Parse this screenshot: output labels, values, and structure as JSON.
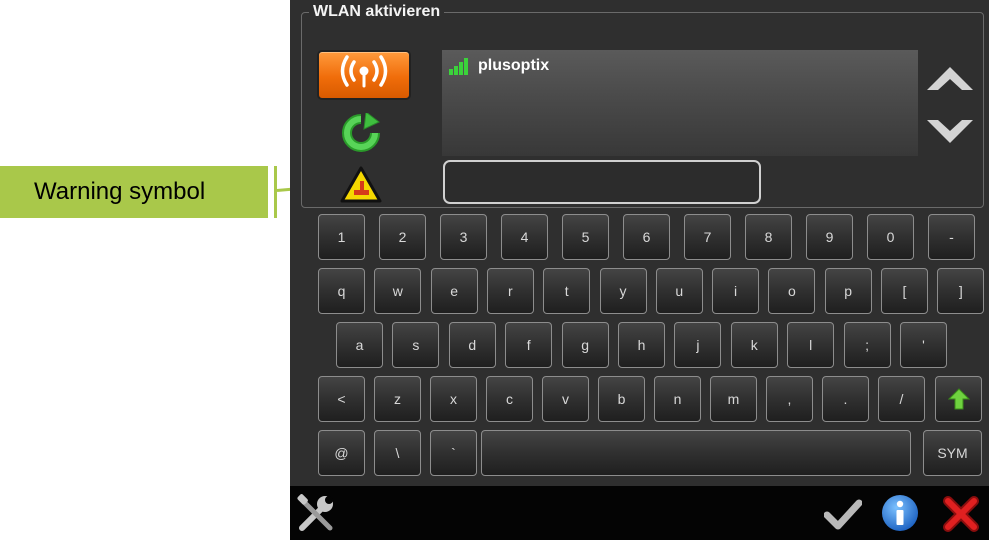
{
  "callout": {
    "label": "Warning symbol"
  },
  "wlan": {
    "title": "WLAN aktivieren"
  },
  "networks": [
    {
      "name": "plusoptix",
      "signal": "strong"
    }
  ],
  "password": {
    "value": "",
    "placeholder": ""
  },
  "keyboard": {
    "row1": [
      "1",
      "2",
      "3",
      "4",
      "5",
      "6",
      "7",
      "8",
      "9",
      "0",
      "-"
    ],
    "row2": [
      "q",
      "w",
      "e",
      "r",
      "t",
      "y",
      "u",
      "i",
      "o",
      "p",
      "[",
      "]"
    ],
    "row3": [
      "a",
      "s",
      "d",
      "f",
      "g",
      "h",
      "j",
      "k",
      "l",
      ";",
      "'"
    ],
    "row4": [
      "<",
      "z",
      "x",
      "c",
      "v",
      "b",
      "n",
      "m",
      ",",
      ".",
      "/"
    ],
    "row5": [
      "@",
      "\\",
      "`"
    ],
    "sym_label": "SYM"
  },
  "icons": {
    "wifi": "wifi-signal-icon",
    "refresh": "refresh-icon",
    "warning": "warning-icon",
    "shift": "shift-arrow-icon",
    "tools": "tools-icon",
    "confirm": "checkmark-icon",
    "info": "info-icon",
    "cancel": "close-icon"
  },
  "colors": {
    "accent_orange": "#f07a1a",
    "callout_green": "#a9c84a",
    "refresh_green": "#3fbf3f",
    "info_blue": "#2a7fe0",
    "close_red": "#e02020",
    "warning_yellow": "#f5d800"
  }
}
